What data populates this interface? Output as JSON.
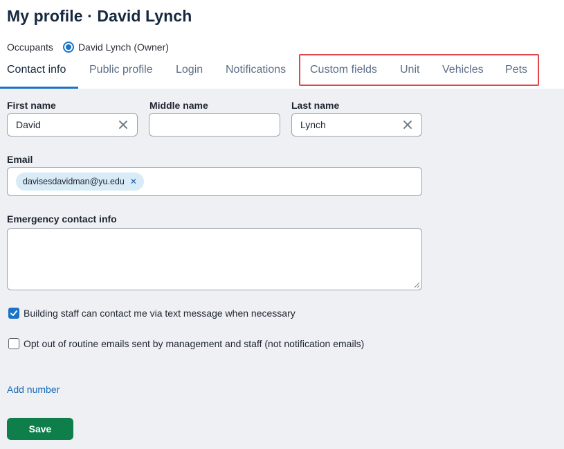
{
  "page": {
    "title": "My profile · David Lynch"
  },
  "occupants": {
    "label": "Occupants",
    "selected": "David Lynch (Owner)"
  },
  "tabs": [
    {
      "label": "Contact info",
      "active": true
    },
    {
      "label": "Public profile",
      "active": false
    },
    {
      "label": "Login",
      "active": false
    },
    {
      "label": "Notifications",
      "active": false
    },
    {
      "label": "Custom fields",
      "active": false
    },
    {
      "label": "Unit",
      "active": false
    },
    {
      "label": "Vehicles",
      "active": false
    },
    {
      "label": "Pets",
      "active": false
    }
  ],
  "form": {
    "first_name": {
      "label": "First name",
      "value": "David"
    },
    "middle_name": {
      "label": "Middle name",
      "value": ""
    },
    "last_name": {
      "label": "Last name",
      "value": "Lynch"
    },
    "email": {
      "label": "Email",
      "chips": [
        "davisesdavidman@yu.edu"
      ]
    },
    "emergency": {
      "label": "Emergency contact info",
      "value": ""
    },
    "text_opt_in": {
      "label": "Building staff can contact me via text message when necessary",
      "checked": true
    },
    "email_opt_out": {
      "label": "Opt out of routine emails sent by management and staff (not notification emails)",
      "checked": false
    },
    "add_number_label": "Add number",
    "save_label": "Save"
  },
  "colors": {
    "accent": "#1a73c6",
    "save": "#0e7e4b",
    "highlight": "#e0474c",
    "background": "#eff0f4"
  }
}
